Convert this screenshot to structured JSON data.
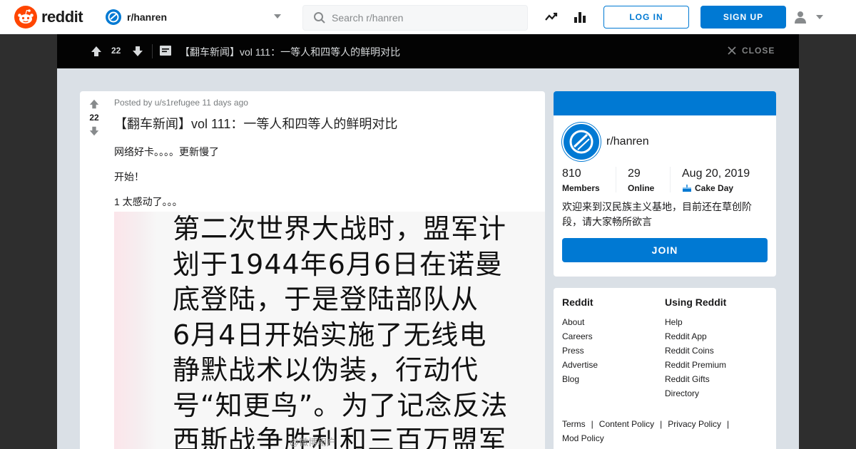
{
  "header": {
    "brand": "reddit",
    "subreddit": "r/hanren",
    "search_placeholder": "Search r/hanren",
    "login_label": "LOG IN",
    "signup_label": "SIGN UP",
    "icons": [
      "trending-icon",
      "stats-icon",
      "user-icon"
    ]
  },
  "overlay": {
    "score": "22",
    "title": "【翻车新闻】vol 111：一等人和四等人的鲜明对比",
    "close_label": "CLOSE"
  },
  "post": {
    "score": "22",
    "meta": "Posted by u/s1refugee 11 days ago",
    "title": "【翻车新闻】vol 111：一等人和四等人的鲜明对比",
    "paragraphs": [
      "网络好卡。。。。更新慢了",
      "开始！",
      "1 太感动了。。。"
    ],
    "image_lines": [
      "第二次世界大战时，盟军计",
      "划于1944年6月6日在诺曼",
      "底登陆，于是登陆部队从",
      "6月4日开始实施了无线电",
      "静默战术以伪装，行动代",
      "号“知更鸟”。为了记念反法",
      "西斯战争胜利和三百万盟军"
    ],
    "image_watermark": "@微博用户"
  },
  "community": {
    "name": "r/hanren",
    "members_value": "810",
    "members_label": "Members",
    "online_value": "29",
    "online_label": "Online",
    "cake_value": "Aug 20, 2019",
    "cake_label": "Cake Day",
    "description": "欢迎来到汉民族主义基地，目前还在草创阶段，请大家畅所欲言",
    "join_label": "JOIN",
    "accent_color": "#0079d3"
  },
  "footer": {
    "col1_title": "Reddit",
    "col1_links": [
      "About",
      "Careers",
      "Press",
      "Advertise",
      "Blog"
    ],
    "col2_title": "Using Reddit",
    "col2_links": [
      "Help",
      "Reddit App",
      "Reddit Coins",
      "Reddit Premium",
      "Reddit Gifts",
      "Directory"
    ],
    "legal": [
      "Terms",
      "Content Policy",
      "Privacy Policy",
      "Mod Policy"
    ]
  }
}
